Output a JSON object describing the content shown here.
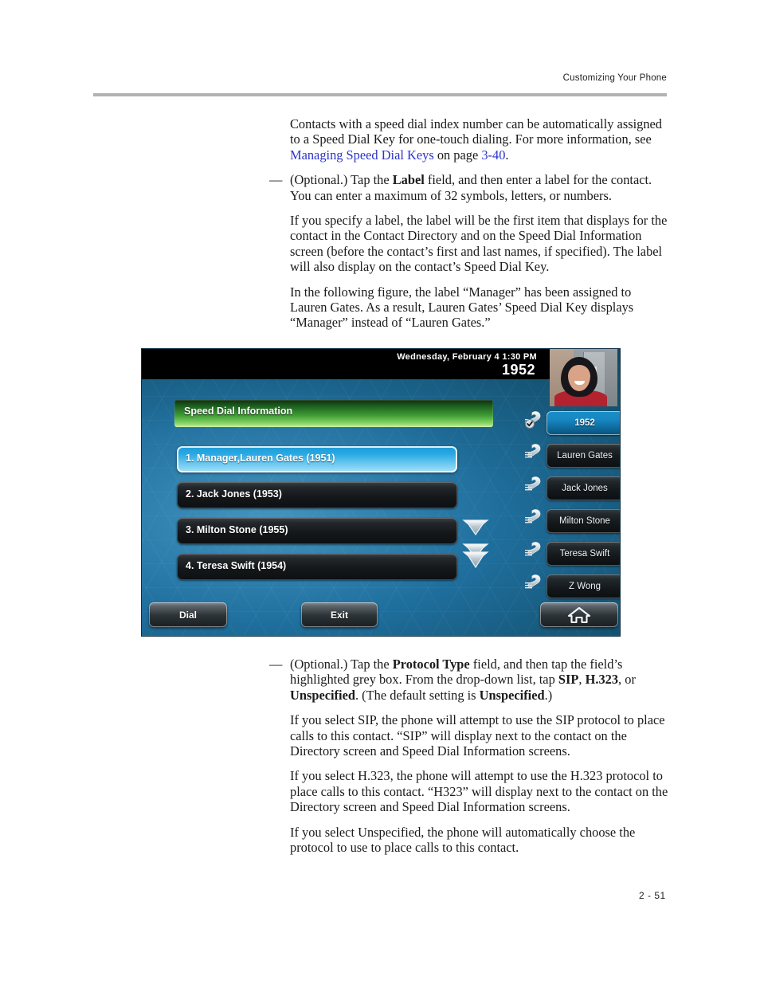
{
  "header": {
    "running_head": "Customizing Your Phone"
  },
  "body": {
    "para_intro": "Contacts with a speed dial index number can be automatically assigned to a Speed Dial Key for one-touch dialing. For more information, see ",
    "para_intro_link": "Managing Speed Dial Keys",
    "para_intro_mid": " on page ",
    "para_intro_pagelink": "3-40",
    "para_intro_end": ".",
    "bullet_label_dash": "—",
    "bullet_label_a": "(Optional.) Tap the ",
    "bullet_label_bold": "Label",
    "bullet_label_b": " field, and then enter a label for the contact. You can enter a maximum of 32 symbols, letters, or numbers.",
    "para_specify": "If you specify a label, the label will be the first item that displays for the contact in the Contact Directory and on the Speed Dial Information screen (before the contact’s first and last names, if specified). The label will also display on the contact’s Speed Dial Key.",
    "para_figure": "In the following figure, the label “Manager” has been assigned to Lauren Gates. As a result, Lauren Gates’ Speed Dial Key displays “Manager” instead of “Lauren Gates.”",
    "bullet_protocol_dash": "—",
    "bullet_protocol_a": "(Optional.) Tap the ",
    "bullet_protocol_bold1": "Protocol Type",
    "bullet_protocol_b": " field, and then tap the field’s highlighted grey box. From the drop-down list, tap ",
    "bullet_protocol_bold2": "SIP",
    "bullet_protocol_c": ", ",
    "bullet_protocol_bold3": "H.323",
    "bullet_protocol_d": ", or ",
    "bullet_protocol_bold4": "Unspecified",
    "bullet_protocol_e": ". (The default setting is ",
    "bullet_protocol_bold5": "Unspecified",
    "bullet_protocol_f": ".)",
    "para_sip": "If you select SIP, the phone will attempt to use the SIP protocol to place calls to this contact. “SIP” will display next to the contact on the Directory screen and Speed Dial Information screens.",
    "para_h323": "If you select H.323, the phone will attempt to use the H.323 protocol to place calls to this contact. “H323” will display next to the contact on the Directory screen and Speed Dial Information screens.",
    "para_unspecified": "If you select Unspecified, the phone will automatically choose the protocol to use to place calls to this contact."
  },
  "figure": {
    "statusbar": {
      "datetime": "Wednesday, February 4  1:30 PM",
      "extension": "1952"
    },
    "screen_title": "Speed Dial Information",
    "rows": [
      {
        "label": "1. Manager,Lauren Gates (1951)",
        "selected": true
      },
      {
        "label": "2. Jack Jones (1953)",
        "selected": false
      },
      {
        "label": "3. Milton Stone (1955)",
        "selected": false
      },
      {
        "label": "4. Teresa Swift (1954)",
        "selected": false
      }
    ],
    "scroll": {
      "down_icon": "chevron-down-icon",
      "page_down_icon": "double-chevron-down-icon"
    },
    "line_keys": [
      {
        "label": "1952",
        "active": true,
        "icon": "handset-registered-icon"
      },
      {
        "label": "Lauren Gates",
        "active": false,
        "icon": "handset-registered-icon"
      },
      {
        "label": "Jack Jones",
        "active": false,
        "icon": "handset-registered-icon"
      },
      {
        "label": "Milton Stone",
        "active": false,
        "icon": "handset-registered-icon"
      },
      {
        "label": "Teresa Swift",
        "active": false,
        "icon": "handset-registered-icon"
      },
      {
        "label": "Z Wong",
        "active": false,
        "icon": "handset-registered-icon"
      }
    ],
    "softkeys": {
      "dial": "Dial",
      "exit": "Exit",
      "home_icon": "home-icon"
    }
  },
  "footer": {
    "page_number": "2 - 51"
  },
  "colors": {
    "link": "#2b34c8",
    "rule": "#b2b2b2",
    "screen_blue": "#1f6f9e",
    "title_green": "#3f9e35",
    "selected_row_blue": "#29a9e4"
  }
}
